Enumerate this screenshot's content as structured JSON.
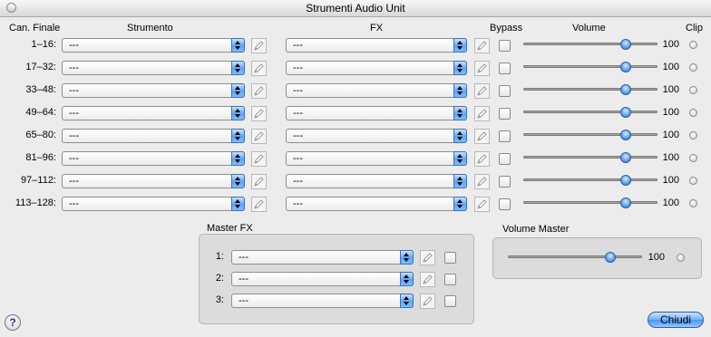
{
  "window": {
    "title": "Strumenti Audio Unit"
  },
  "headers": {
    "channel": "Can. Finale",
    "instrument": "Strumento",
    "fx": "FX",
    "bypass": "Bypass",
    "volume": "Volume",
    "clip": "Clip"
  },
  "rows": [
    {
      "label": "1–16:",
      "instrument": "---",
      "fx": "---",
      "volume": 100,
      "volume_text": "100"
    },
    {
      "label": "17–32:",
      "instrument": "---",
      "fx": "---",
      "volume": 100,
      "volume_text": "100"
    },
    {
      "label": "33–48:",
      "instrument": "---",
      "fx": "---",
      "volume": 100,
      "volume_text": "100"
    },
    {
      "label": "49–64:",
      "instrument": "---",
      "fx": "---",
      "volume": 100,
      "volume_text": "100"
    },
    {
      "label": "65–80:",
      "instrument": "---",
      "fx": "---",
      "volume": 100,
      "volume_text": "100"
    },
    {
      "label": "81–96:",
      "instrument": "---",
      "fx": "---",
      "volume": 100,
      "volume_text": "100"
    },
    {
      "label": "97–112:",
      "instrument": "---",
      "fx": "---",
      "volume": 100,
      "volume_text": "100"
    },
    {
      "label": "113–128:",
      "instrument": "---",
      "fx": "---",
      "volume": 100,
      "volume_text": "100"
    }
  ],
  "master_fx": {
    "title": "Master FX",
    "items": [
      {
        "label": "1:",
        "value": "---"
      },
      {
        "label": "2:",
        "value": "---"
      },
      {
        "label": "3:",
        "value": "---"
      }
    ]
  },
  "master_volume": {
    "title": "Volume Master",
    "value": 100,
    "value_text": "100"
  },
  "buttons": {
    "help": "?",
    "close": "Chiudi"
  }
}
